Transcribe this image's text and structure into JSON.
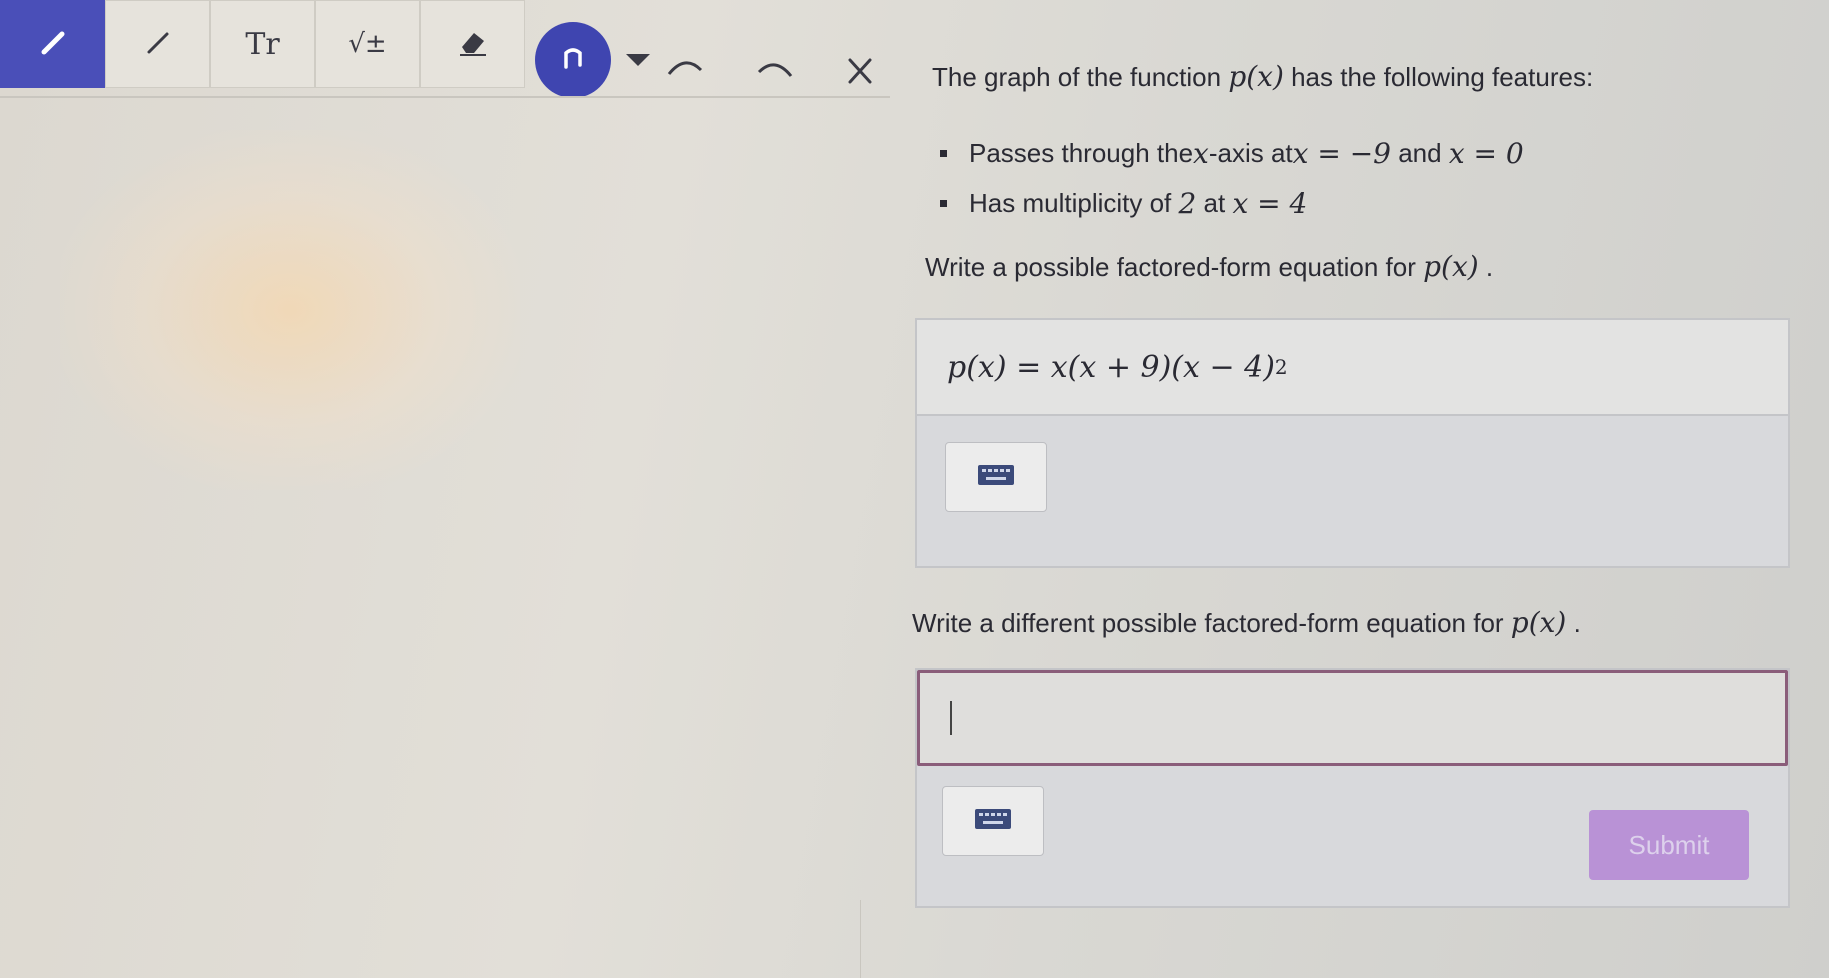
{
  "toolbar": {
    "tools": [
      {
        "name": "pen-tool",
        "icon": "pencil-icon",
        "active": true
      },
      {
        "name": "line-tool",
        "icon": "line-icon",
        "active": false
      },
      {
        "name": "text-tool",
        "icon": "text-icon",
        "label": "Tr",
        "active": false
      },
      {
        "name": "math-tool",
        "icon": "sqrt-icon",
        "label": "√±",
        "active": false
      },
      {
        "name": "eraser-tool",
        "icon": "eraser-icon",
        "active": false
      }
    ],
    "undo_icon": "undo-icon",
    "dropdown_icon": "caret-down-icon",
    "redo_icons": [
      "arc-left-icon",
      "arc-right-icon"
    ],
    "close_icon": "close-icon",
    "accent": "#4a4fb8"
  },
  "question": {
    "intro_pre": "The graph of the function ",
    "intro_func": "p(x)",
    "intro_post": " has the following features:",
    "bullets": [
      {
        "text_pre": "Passes through the ",
        "var": "x",
        "text_mid": "-axis at ",
        "math1": "x = −9",
        "and": " and ",
        "math2": "x = 0"
      },
      {
        "text_pre": "Has multiplicity of ",
        "math1": "2",
        "text_mid": " at ",
        "math2": "x = 4"
      }
    ],
    "prompt1_pre": "Write a possible factored-form equation for ",
    "prompt1_func": "p(x)",
    "prompt1_post": " .",
    "answer1": "p(x) = x(x + 9)(x − 4)",
    "answer1_exp": "2",
    "prompt2_pre": "Write a different possible factored-form equation for ",
    "prompt2_func": "p(x)",
    "prompt2_post": " .",
    "answer2": "",
    "keyboard_icon": "keyboard-icon",
    "submit_label": "Submit",
    "submit_color": "#b992d6"
  }
}
